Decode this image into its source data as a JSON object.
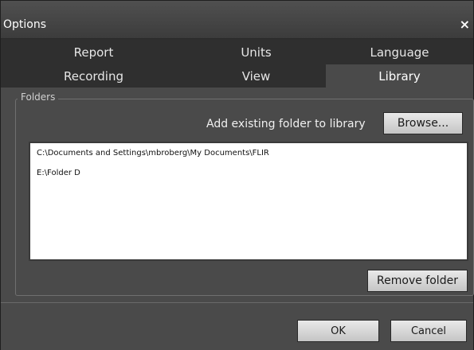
{
  "window": {
    "title": "Options",
    "close_glyph": "×"
  },
  "tabs": {
    "row1": [
      {
        "label": "Report"
      },
      {
        "label": "Units"
      },
      {
        "label": "Language"
      }
    ],
    "row2": [
      {
        "label": "Recording"
      },
      {
        "label": "View"
      },
      {
        "label": "Library",
        "active": true
      }
    ]
  },
  "folders": {
    "legend": "Folders",
    "add_label": "Add existing folder to library",
    "browse_label": "Browse...",
    "items": [
      "C:\\Documents and Settings\\mbroberg\\My Documents\\FLIR",
      "E:\\Folder D"
    ],
    "remove_label": "Remove folder"
  },
  "footer": {
    "ok_label": "OK",
    "cancel_label": "Cancel"
  },
  "colors": {
    "dialog_bg": "#4a4a4a",
    "tab_bar_bg": "#2f2f2f",
    "active_tab_bg": "#4a4a4a",
    "list_bg": "#ffffff"
  },
  "icons": {
    "close": "close-icon"
  }
}
